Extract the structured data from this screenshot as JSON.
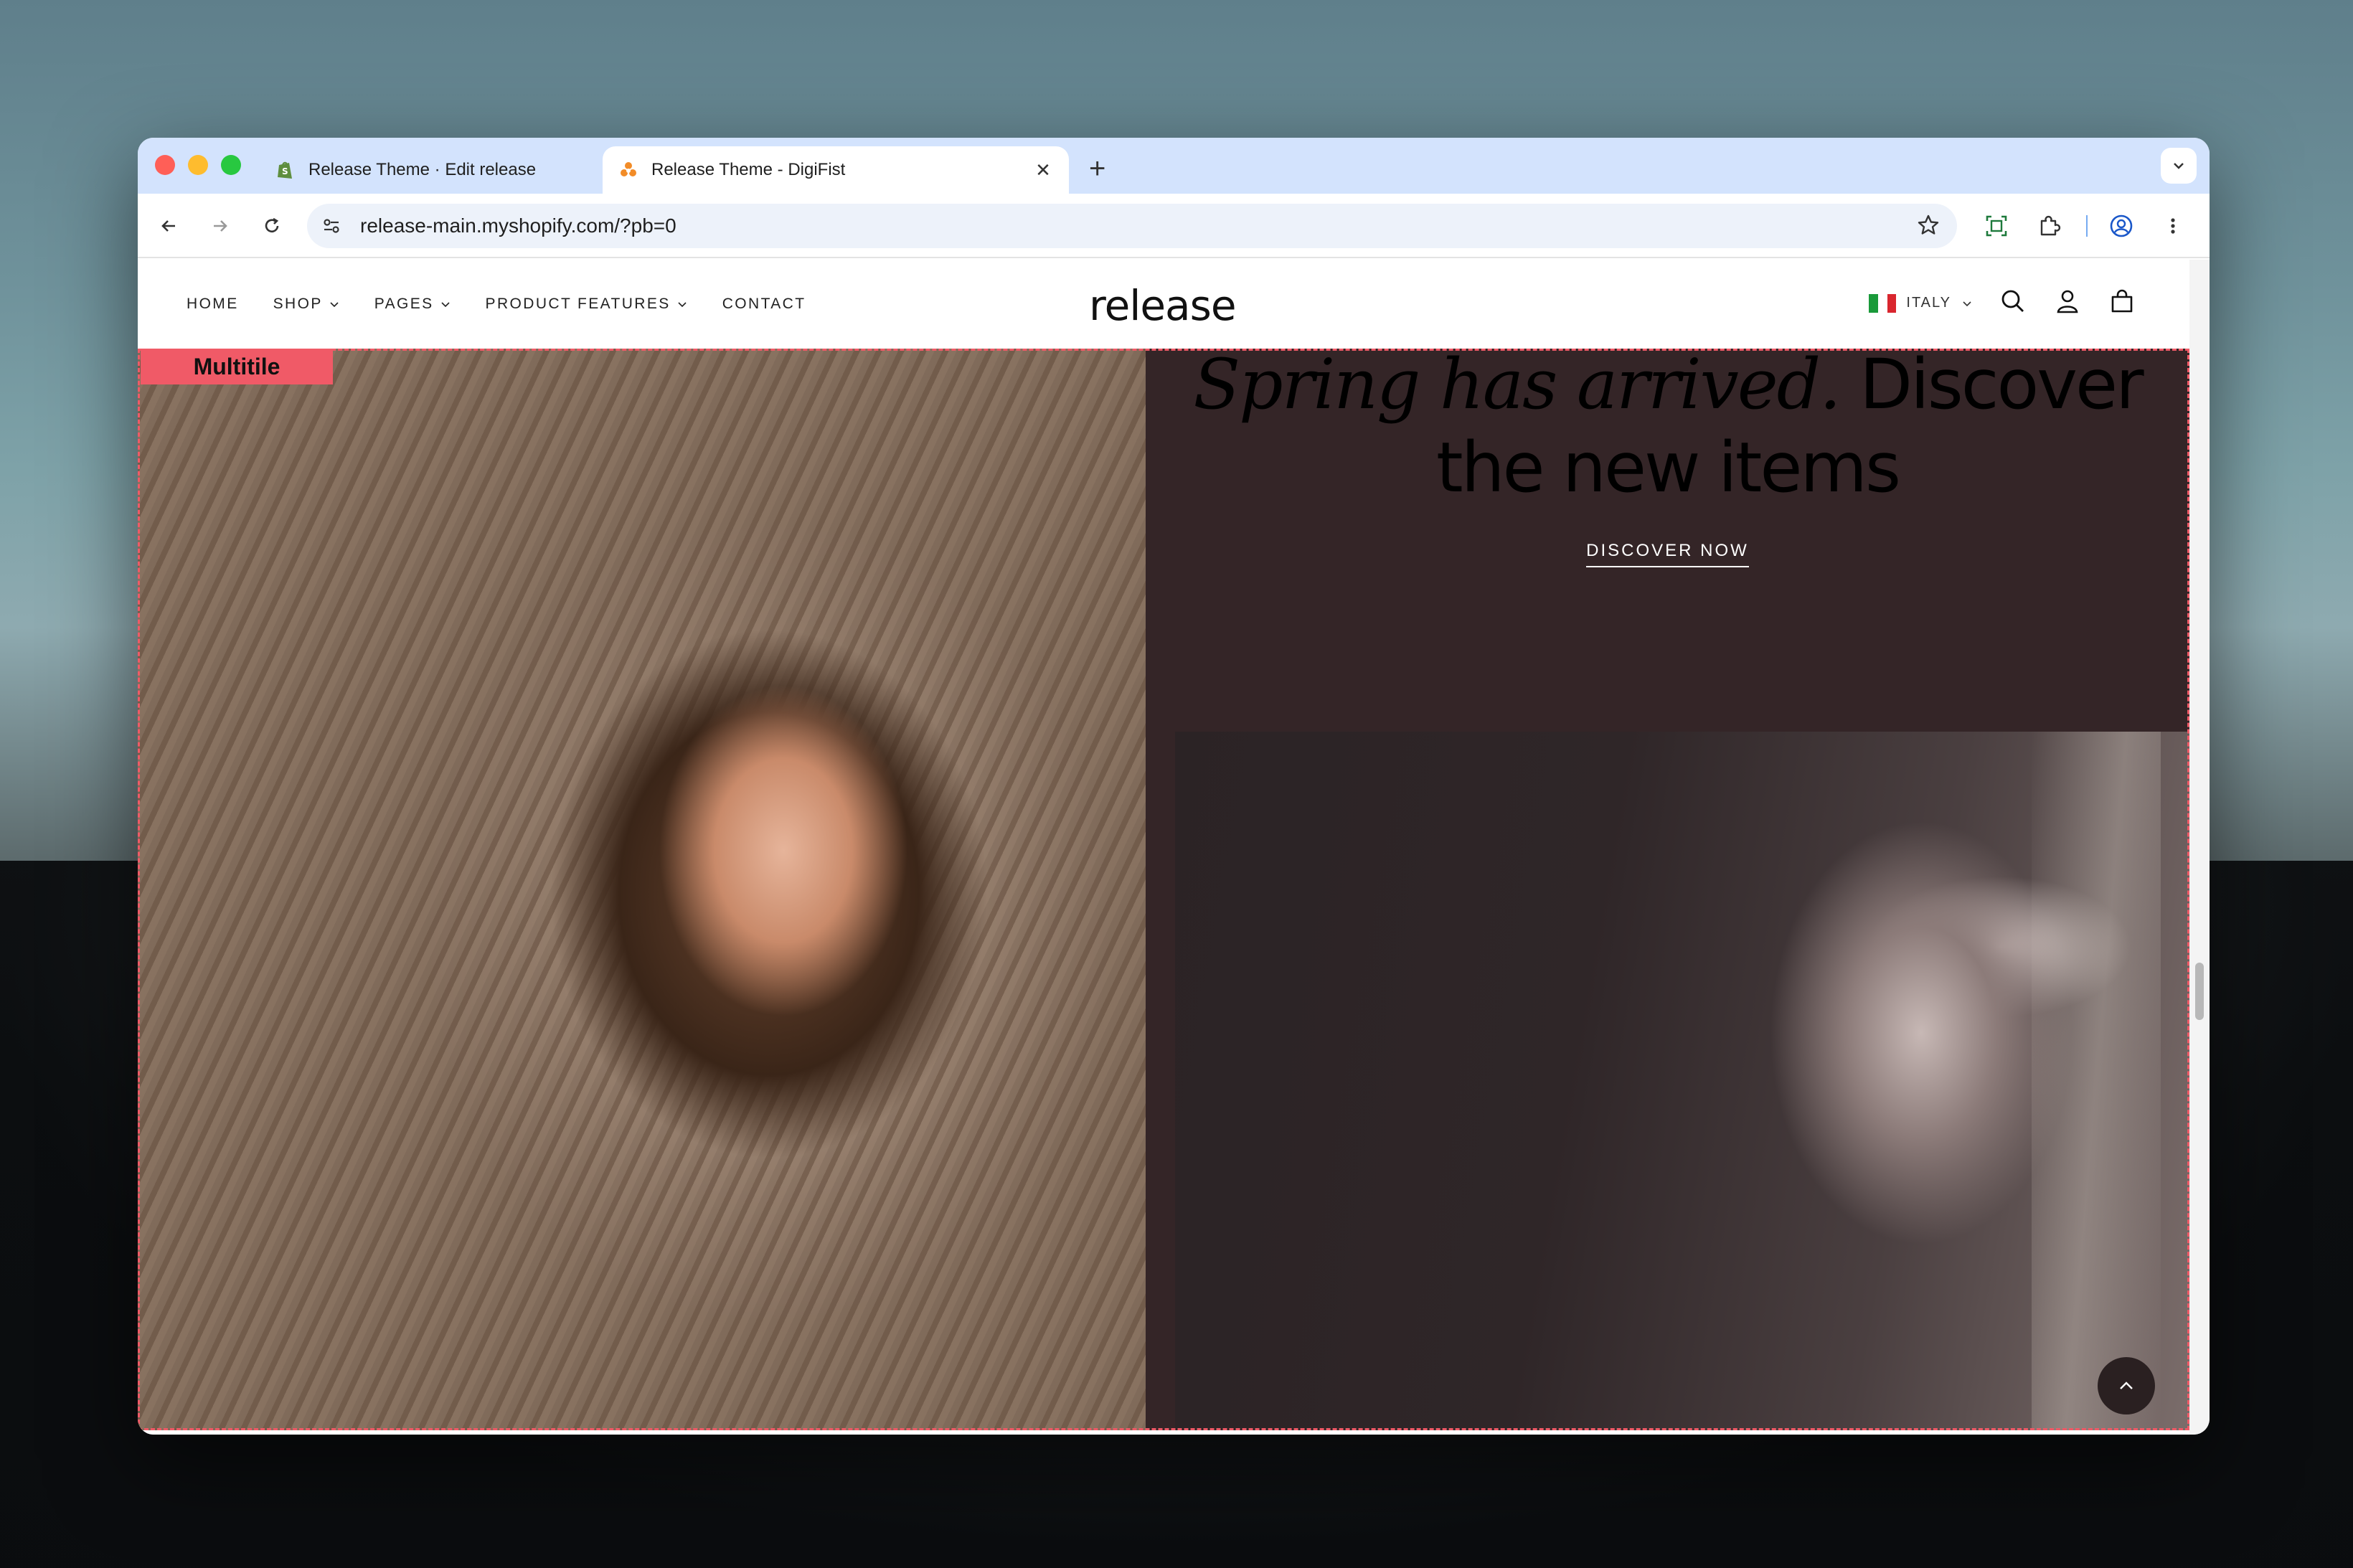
{
  "browser": {
    "tabs": [
      {
        "title": "Release Theme · Edit release",
        "favicon": "shopify-icon",
        "active": false
      },
      {
        "title": "Release Theme - DigiFist",
        "favicon": "digifist-icon",
        "active": true
      }
    ],
    "new_tab_label": "+",
    "close_glyph": "✕",
    "url": "release-main.myshopify.com/?pb=0"
  },
  "site": {
    "logo": "release",
    "nav": [
      {
        "label": "HOME",
        "has_dropdown": false
      },
      {
        "label": "SHOP",
        "has_dropdown": true
      },
      {
        "label": "PAGES",
        "has_dropdown": true
      },
      {
        "label": "PRODUCT FEATURES",
        "has_dropdown": true
      },
      {
        "label": "CONTACT",
        "has_dropdown": false
      }
    ],
    "locale": "ITALY"
  },
  "section": {
    "badge": "Multitile",
    "hero_italic": "Spring has arrived.",
    "hero_normal": " Discover",
    "hero_line2": "the new items",
    "cta": "DISCOVER NOW"
  },
  "colors": {
    "badge": "#f05a67",
    "tile_bg": "#342527",
    "tabbar": "#d3e3fd"
  }
}
